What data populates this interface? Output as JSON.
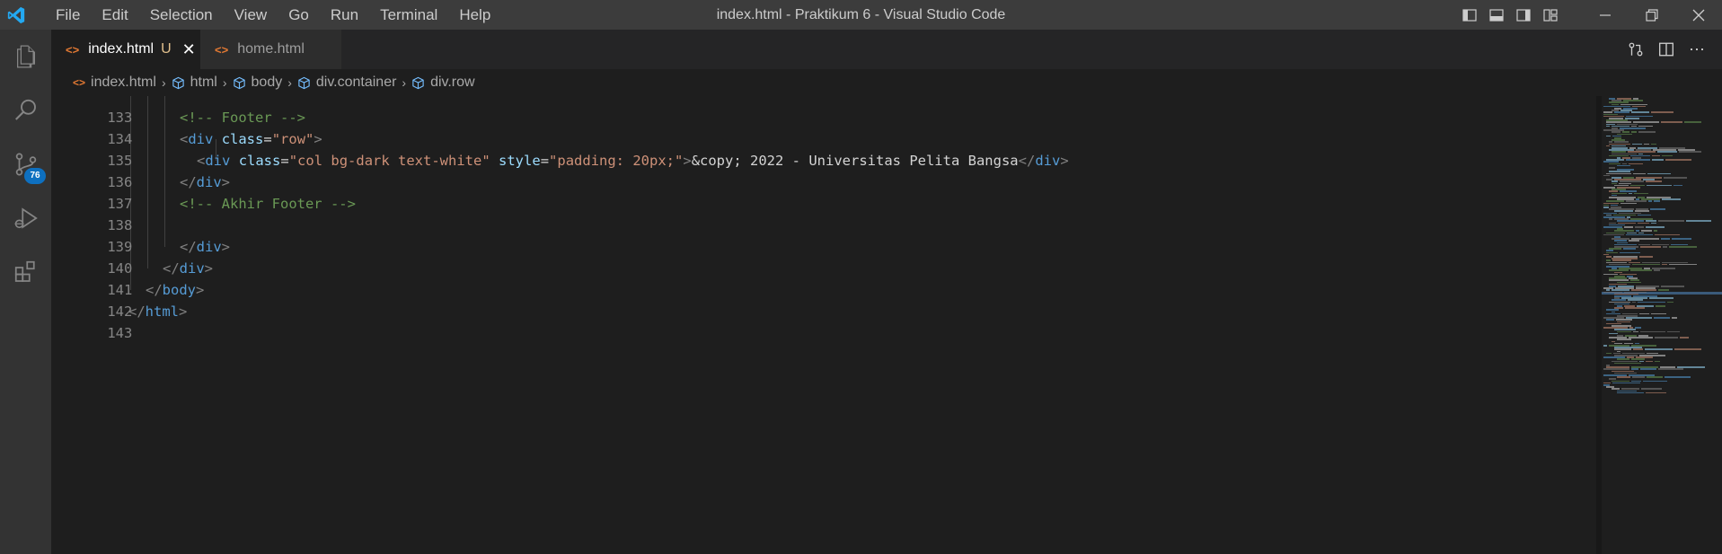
{
  "titlebar": {
    "menu": [
      "File",
      "Edit",
      "Selection",
      "View",
      "Go",
      "Run",
      "Terminal",
      "Help"
    ],
    "window_title": "index.html - Praktikum 6 - Visual Studio Code"
  },
  "activitybar": {
    "source_control_badge": "76"
  },
  "tabs": [
    {
      "label": "index.html",
      "status": "U",
      "active": true
    },
    {
      "label": "home.html",
      "active": false
    }
  ],
  "breadcrumbs": [
    "index.html",
    "html",
    "body",
    "div.container",
    "div.row"
  ],
  "editor": {
    "lines": [
      {
        "num": "133",
        "text": ""
      },
      {
        "num": "134",
        "text": "<!-- Footer -->"
      },
      {
        "num": "135",
        "tag": "div",
        "attr": "class",
        "value": "\"row\""
      },
      {
        "num": "136",
        "text": "&copy; 2022 - Universitas Pelita Bangsa",
        "tag": "div",
        "attr1": "class",
        "value1": "\"col bg-dark text-white\"",
        "attr2": "style",
        "value2": "\"padding: 20px;\""
      },
      {
        "num": "137",
        "close": "div"
      },
      {
        "num": "138",
        "text": "<!-- Akhir Footer -->"
      },
      {
        "num": "139",
        "text": ""
      },
      {
        "num": "140",
        "close": "div"
      },
      {
        "num": "141",
        "close": "div"
      },
      {
        "num": "142",
        "close": "body"
      },
      {
        "num": "143",
        "close": "html"
      }
    ]
  },
  "colors": {
    "titlebar_bg": "#3c3c3c",
    "activitybar_bg": "#333333",
    "editor_bg": "#1e1e1e",
    "badge_bg": "#0e70c0",
    "accent_blue": "#007acc"
  }
}
